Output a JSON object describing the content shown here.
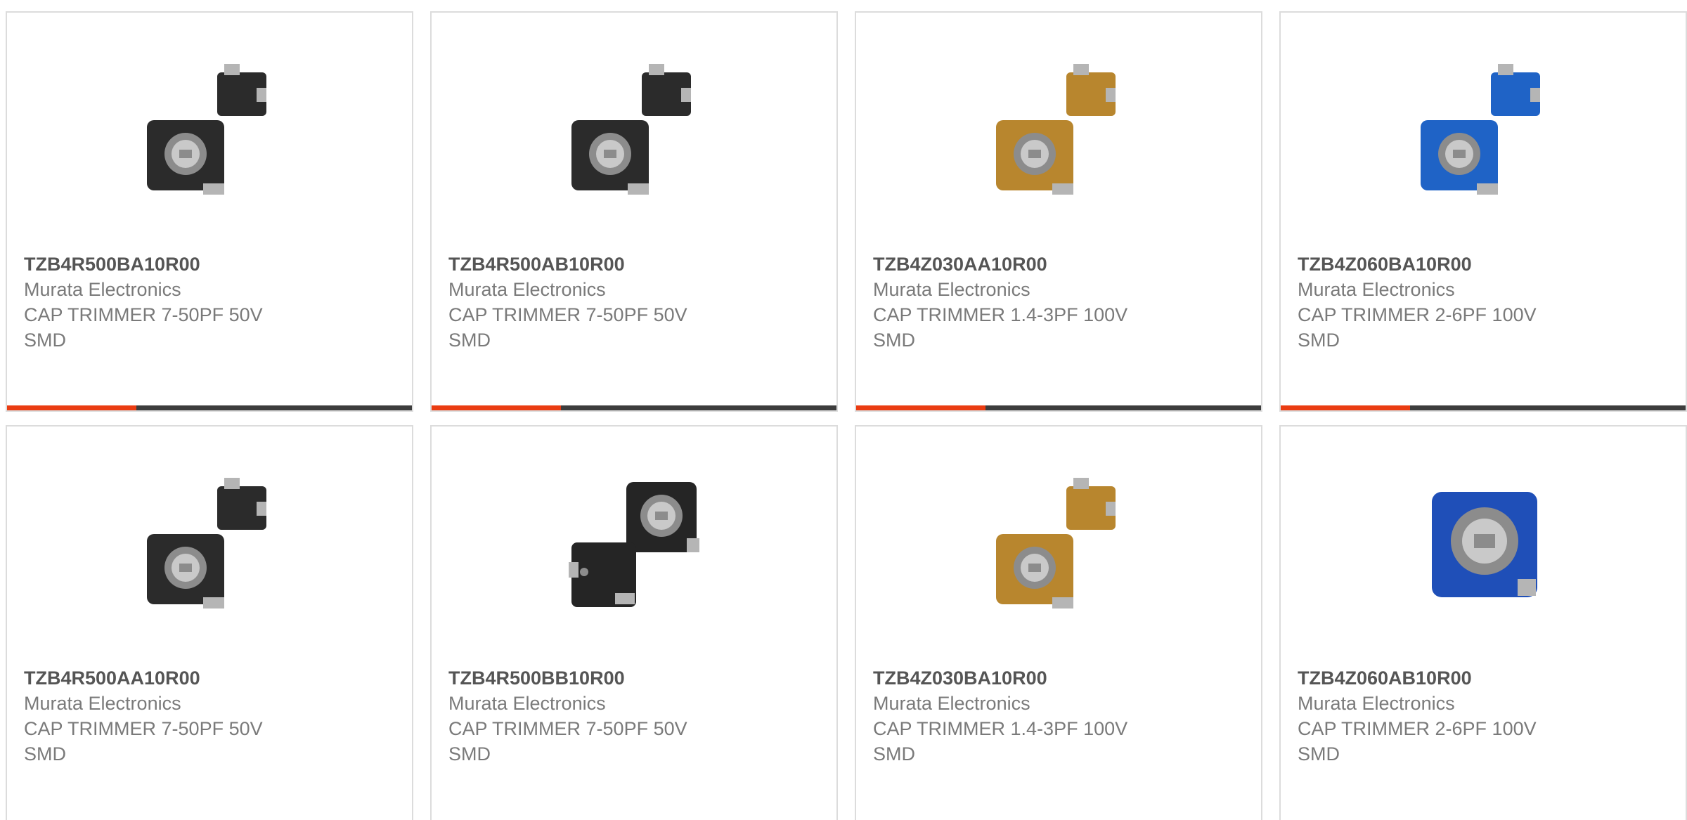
{
  "accent_color": "#ea3c12",
  "bar_color": "#3d3d3d",
  "products": [
    {
      "part_number": "TZB4R500BA10R00",
      "manufacturer": "Murata Electronics",
      "description_line1": "CAP TRIMMER 7-50PF 50V",
      "description_line2": "SMD",
      "image_icon": "black-trimmer-capacitor-image",
      "body_color": "#2b2b2b"
    },
    {
      "part_number": "TZB4R500AB10R00",
      "manufacturer": "Murata Electronics",
      "description_line1": "CAP TRIMMER 7-50PF 50V",
      "description_line2": "SMD",
      "image_icon": "black-trimmer-capacitor-image",
      "body_color": "#2b2b2b"
    },
    {
      "part_number": "TZB4Z030AA10R00",
      "manufacturer": "Murata Electronics",
      "description_line1": "CAP TRIMMER 1.4-3PF 100V",
      "description_line2": "SMD",
      "image_icon": "tan-trimmer-capacitor-image",
      "body_color": "#b8862e"
    },
    {
      "part_number": "TZB4Z060BA10R00",
      "manufacturer": "Murata Electronics",
      "description_line1": "CAP TRIMMER 2-6PF 100V",
      "description_line2": "SMD",
      "image_icon": "blue-trimmer-capacitor-image",
      "body_color": "#1f63c6"
    },
    {
      "part_number": "TZB4R500AA10R00",
      "manufacturer": "Murata Electronics",
      "description_line1": "CAP TRIMMER 7-50PF 50V",
      "description_line2": "SMD",
      "image_icon": "black-trimmer-capacitor-image",
      "body_color": "#2b2b2b"
    },
    {
      "part_number": "TZB4R500BB10R00",
      "manufacturer": "Murata Electronics",
      "description_line1": "CAP TRIMMER 7-50PF 50V",
      "description_line2": "SMD",
      "image_icon": "black-trimmer-capacitor-image",
      "body_color": "#252525"
    },
    {
      "part_number": "TZB4Z030BA10R00",
      "manufacturer": "Murata Electronics",
      "description_line1": "CAP TRIMMER 1.4-3PF 100V",
      "description_line2": "SMD",
      "image_icon": "tan-trimmer-capacitor-image",
      "body_color": "#b8862e"
    },
    {
      "part_number": "TZB4Z060AB10R00",
      "manufacturer": "Murata Electronics",
      "description_line1": "CAP TRIMMER 2-6PF 100V",
      "description_line2": "SMD",
      "image_icon": "blue-trimmer-capacitor-image",
      "body_color": "#1f4fb8"
    }
  ]
}
